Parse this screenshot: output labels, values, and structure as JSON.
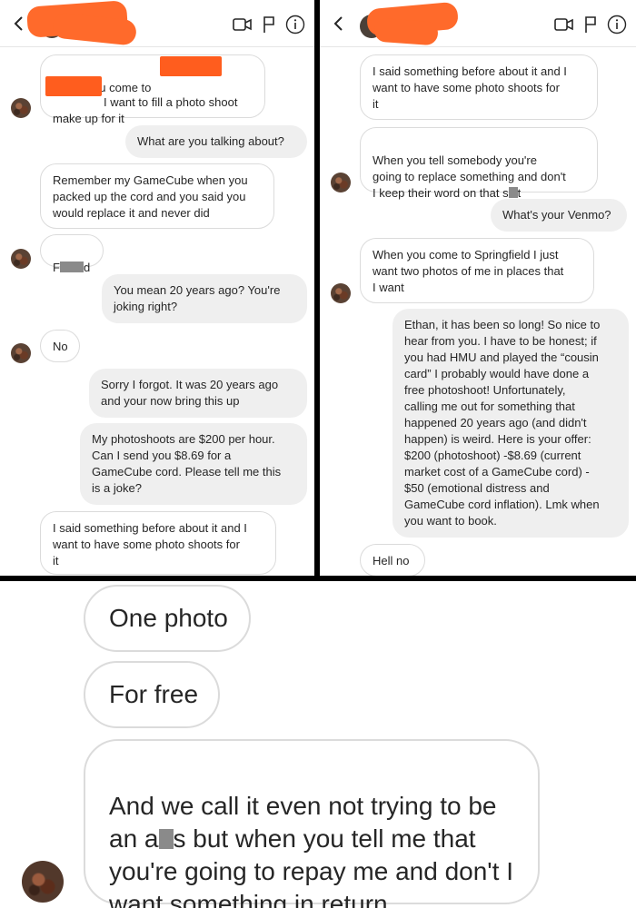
{
  "left": {
    "msgs": {
      "m1_a": "When you come to",
      "m1_b": "I want to fill a photo shoot",
      "m1_c": "make up for it",
      "m2": "What are you talking about?",
      "m3": "Remember my GameCube when you\npacked up the cord and you said you\nwould replace it and never did",
      "m4_a": "F",
      "m4_b": "d",
      "m5": "You mean 20 years ago? You're\njoking right?",
      "m6": "No",
      "m7": "Sorry I forgot. It was 20 years ago\nand your now bring this up",
      "m8": "My photoshoots are $200 per hour.\nCan I send you $8.69 for a\nGameCube cord. Please tell me this\nis a joke?",
      "m9": "I said something before about it and I\nwant to have some photo shoots for\nit"
    }
  },
  "right": {
    "msgs": {
      "m1": "I said something before about it and I\nwant to have some photo shoots for\nit",
      "m2_a": "When you tell somebody you're\ngoing to replace something and don't\nI keep their word on that s",
      "m2_b": "t",
      "m3": "What's your Venmo?",
      "m4": "When you come to Springfield I just\nwant two photos of me in places that\nI want",
      "m5": "Ethan, it has been so long! So nice to\nhear from you. I have to be honest; if\nyou had HMU and played the “cousin\ncard” I probably would have done a\nfree photoshoot! Unfortunately,\ncalling me out for something that\nhappened 20 years ago (and didn't\nhappen) is weird. Here is your offer:\n$200 (photoshoot) -$8.69 (current\nmarket cost of a GameCube cord) -\n$50 (emotional distress and\nGameCube cord inflation). Lmk when\nyou want to book.",
      "m6": "Hell no"
    }
  },
  "bottom": {
    "msgs": {
      "b1": "One photo",
      "b2": "For free",
      "b3_a": "And we call it even not trying to be\nan a",
      "b3_b": "s but when you tell me that\nyou're going to repay me and don't I\nwant something in return"
    }
  },
  "colors": {
    "redaction": "#ff5d1e",
    "incoming_border": "#dbdbdb",
    "outgoing_bg": "#efefef"
  },
  "icons": [
    "back-chevron-icon",
    "video-call-icon",
    "flag-icon",
    "info-icon"
  ]
}
